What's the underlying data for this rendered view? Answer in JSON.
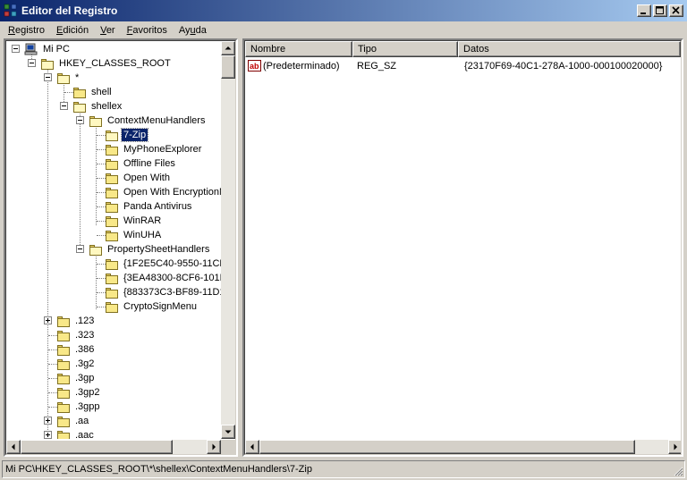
{
  "window": {
    "title": "Editor del Registro"
  },
  "menu": [
    {
      "pre": "",
      "u": "R",
      "post": "egistro"
    },
    {
      "pre": "",
      "u": "E",
      "post": "dición"
    },
    {
      "pre": "",
      "u": "V",
      "post": "er"
    },
    {
      "pre": "",
      "u": "F",
      "post": "avoritos"
    },
    {
      "pre": "Ay",
      "u": "u",
      "post": "da"
    }
  ],
  "tree": {
    "root": "Mi PC",
    "hkcr": "HKEY_CLASSES_ROOT",
    "star": "*",
    "shell": "shell",
    "shellex": "shellex",
    "context_menu_handlers": "ContextMenuHandlers",
    "cmh_items": [
      "7-Zip",
      "MyPhoneExplorer",
      "Offline Files",
      "Open With",
      "Open With EncryptionM",
      "Panda Antivirus",
      "WinRAR",
      "WinUHA"
    ],
    "property_sheet_handlers": "PropertySheetHandlers",
    "psh_items": [
      "{1F2E5C40-9550-11CE",
      "{3EA48300-8CF6-101E",
      "{883373C3-BF89-11D1",
      "CryptoSignMenu"
    ],
    "extensions": [
      {
        "name": ".123",
        "expandable": true
      },
      {
        "name": ".323",
        "expandable": false
      },
      {
        "name": ".386",
        "expandable": false
      },
      {
        "name": ".3g2",
        "expandable": false
      },
      {
        "name": ".3gp",
        "expandable": false
      },
      {
        "name": ".3gp2",
        "expandable": false
      },
      {
        "name": ".3gpp",
        "expandable": false
      },
      {
        "name": ".aa",
        "expandable": true
      },
      {
        "name": ".aac",
        "expandable": true
      }
    ],
    "selected": "7-Zip"
  },
  "list": {
    "columns": [
      "Nombre",
      "Tipo",
      "Datos"
    ],
    "rows": [
      {
        "name": "(Predeterminado)",
        "type": "REG_SZ",
        "data": "{23170F69-40C1-278A-1000-000100020000}"
      }
    ]
  },
  "status": {
    "path": "Mi PC\\HKEY_CLASSES_ROOT\\*\\shellex\\ContextMenuHandlers\\7-Zip"
  },
  "colors": {
    "title_start": "#0a246a",
    "title_end": "#a6caf0",
    "selection": "#0a246a",
    "face": "#d4d0c8",
    "folder": "#f8e888"
  },
  "icons": [
    "registry-editor-icon",
    "computer-icon",
    "folder-icon",
    "string-value-icon",
    "minimize-icon",
    "maximize-icon",
    "close-icon"
  ]
}
